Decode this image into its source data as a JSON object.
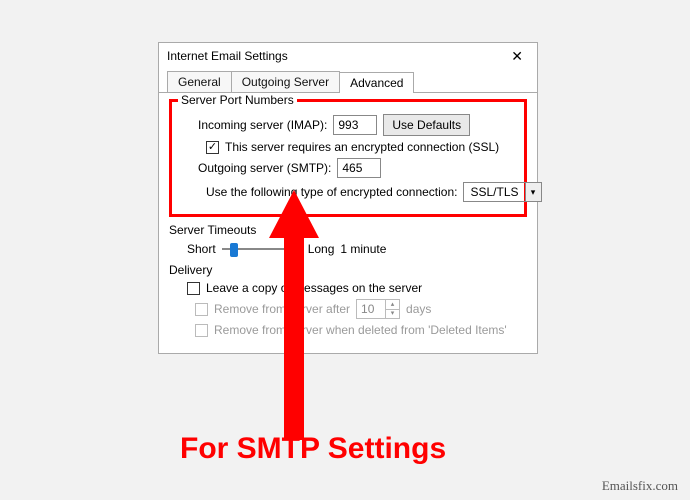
{
  "window": {
    "title": "Internet Email Settings",
    "close_glyph": "✕"
  },
  "tabs": {
    "general": "General",
    "outgoing": "Outgoing Server",
    "advanced": "Advanced"
  },
  "ports": {
    "legend": "Server Port Numbers",
    "incoming_label": "Incoming server (IMAP):",
    "incoming_value": "993",
    "defaults_btn": "Use Defaults",
    "ssl_checkbox_label": "This server requires an encrypted connection (SSL)",
    "ssl_checked_glyph": "✓",
    "outgoing_label": "Outgoing server (SMTP):",
    "outgoing_value": "465",
    "enc_label": "Use the following type of encrypted connection:",
    "enc_value": "SSL/TLS",
    "enc_arrow": "▾"
  },
  "timeouts": {
    "legend": "Server Timeouts",
    "short": "Short",
    "long": "Long",
    "value": "1 minute"
  },
  "delivery": {
    "legend": "Delivery",
    "leave_copy": "Leave a copy of messages on the server",
    "remove_after": "Remove from server after",
    "days_value": "10",
    "days_unit": "days",
    "spinner_up": "▴",
    "spinner_down": "▾",
    "remove_deleted": "Remove from server when deleted from 'Deleted Items'"
  },
  "annotation": {
    "text": "For SMTP Settings"
  },
  "watermark": "Emailsfix.com",
  "colors": {
    "highlight": "#ff0000"
  }
}
